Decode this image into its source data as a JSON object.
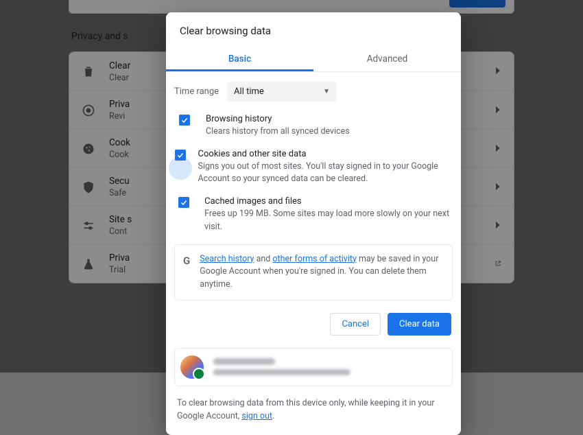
{
  "background": {
    "section_title": "Privacy and s",
    "items": [
      {
        "title": "Clear",
        "subtitle": "Clear"
      },
      {
        "title": "Priva",
        "subtitle": "Revi"
      },
      {
        "title": "Cook",
        "subtitle": "Cook"
      },
      {
        "title": "Secu",
        "subtitle": "Safe"
      },
      {
        "title": "Site s",
        "subtitle": "Cont"
      },
      {
        "title": "Priva",
        "subtitle": "Trial"
      }
    ]
  },
  "modal": {
    "title": "Clear browsing data",
    "tabs": {
      "basic": "Basic",
      "advanced": "Advanced"
    },
    "time_range": {
      "label": "Time range",
      "value": "All time"
    },
    "options": {
      "history": {
        "title": "Browsing history",
        "desc": "Clears history from all synced devices"
      },
      "cookies": {
        "title": "Cookies and other site data",
        "desc": "Signs you out of most sites. You'll stay signed in to your Google Account so your synced data can be cleared."
      },
      "cache": {
        "title": "Cached images and files",
        "desc": "Frees up 199 MB. Some sites may load more slowly on your next visit."
      }
    },
    "info": {
      "link1": "Search history",
      "mid": " and ",
      "link2": "other forms of activity",
      "tail": " may be saved in your Google Account when you're signed in. You can delete them anytime."
    },
    "actions": {
      "cancel": "Cancel",
      "clear": "Clear data"
    },
    "footer": {
      "pre": "To clear browsing data from this device only, while keeping it in your Google Account, ",
      "link": "sign out",
      "post": "."
    }
  }
}
